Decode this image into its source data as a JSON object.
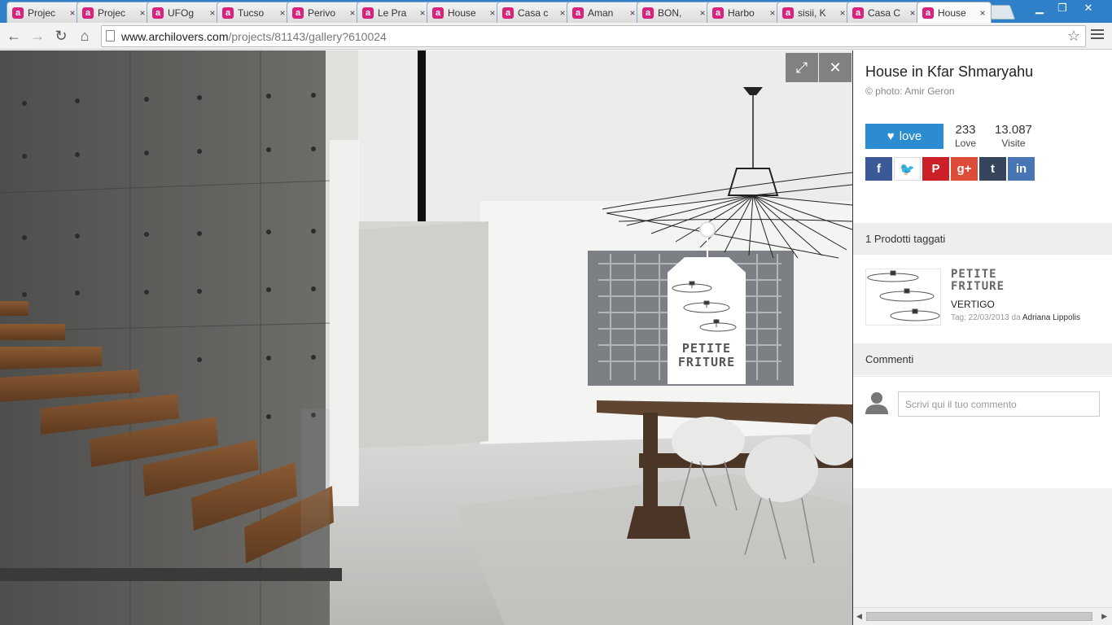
{
  "browser": {
    "tabs": [
      {
        "title": "Projec",
        "active": false
      },
      {
        "title": "Projec",
        "active": false
      },
      {
        "title": "UFOg",
        "active": false
      },
      {
        "title": "Tucso",
        "active": false
      },
      {
        "title": "Perivo",
        "active": false
      },
      {
        "title": "Le Pra",
        "active": false
      },
      {
        "title": "House",
        "active": false
      },
      {
        "title": "Casa c",
        "active": false
      },
      {
        "title": "Aman",
        "active": false
      },
      {
        "title": "BON,",
        "active": false
      },
      {
        "title": "Harbo",
        "active": false
      },
      {
        "title": "sisii, K",
        "active": false
      },
      {
        "title": "Casa C",
        "active": false
      },
      {
        "title": "House",
        "active": true
      }
    ],
    "favicon_letter": "a",
    "tab_close_glyph": "×",
    "url_domain": "www.archilovers.com",
    "url_path": "/projects/81143/gallery?610024",
    "accent_color": "#d7227e",
    "tabstrip_color": "#2f80c8"
  },
  "viewer": {
    "fullscreen_icon": "expand-icon",
    "close_icon": "close-icon",
    "tag_brand": "PETITE FRITURE"
  },
  "sidebar": {
    "title": "House in Kfar Shmaryahu",
    "credit": "© photo: Amir Geron",
    "love_label": "love",
    "love_count": "233",
    "love_count_label": "Love",
    "visits_count": "13.087",
    "visits_label": "Visite",
    "social": [
      {
        "icon": "facebook-icon",
        "glyph": "f",
        "color": "#3b5998"
      },
      {
        "icon": "twitter-icon",
        "glyph": "🐦",
        "color": "#ffffff"
      },
      {
        "icon": "pinterest-icon",
        "glyph": "P",
        "color": "#cb2027"
      },
      {
        "icon": "google-plus-icon",
        "glyph": "g+",
        "color": "#dd4b39"
      },
      {
        "icon": "tumblr-icon",
        "glyph": "t",
        "color": "#35465c"
      },
      {
        "icon": "linkedin-icon",
        "glyph": "in",
        "color": "#4875b4"
      }
    ],
    "products_heading": "1 Prodotti taggati",
    "product": {
      "brand_line1": "PETITE",
      "brand_line2": "FRITURE",
      "name": "VERTIGO",
      "meta": "Tag: 22/03/2013 da",
      "author": "Adriana Lippolis"
    },
    "comments_heading": "Commenti",
    "comment_placeholder": "Scrivi qui il tuo commento"
  }
}
